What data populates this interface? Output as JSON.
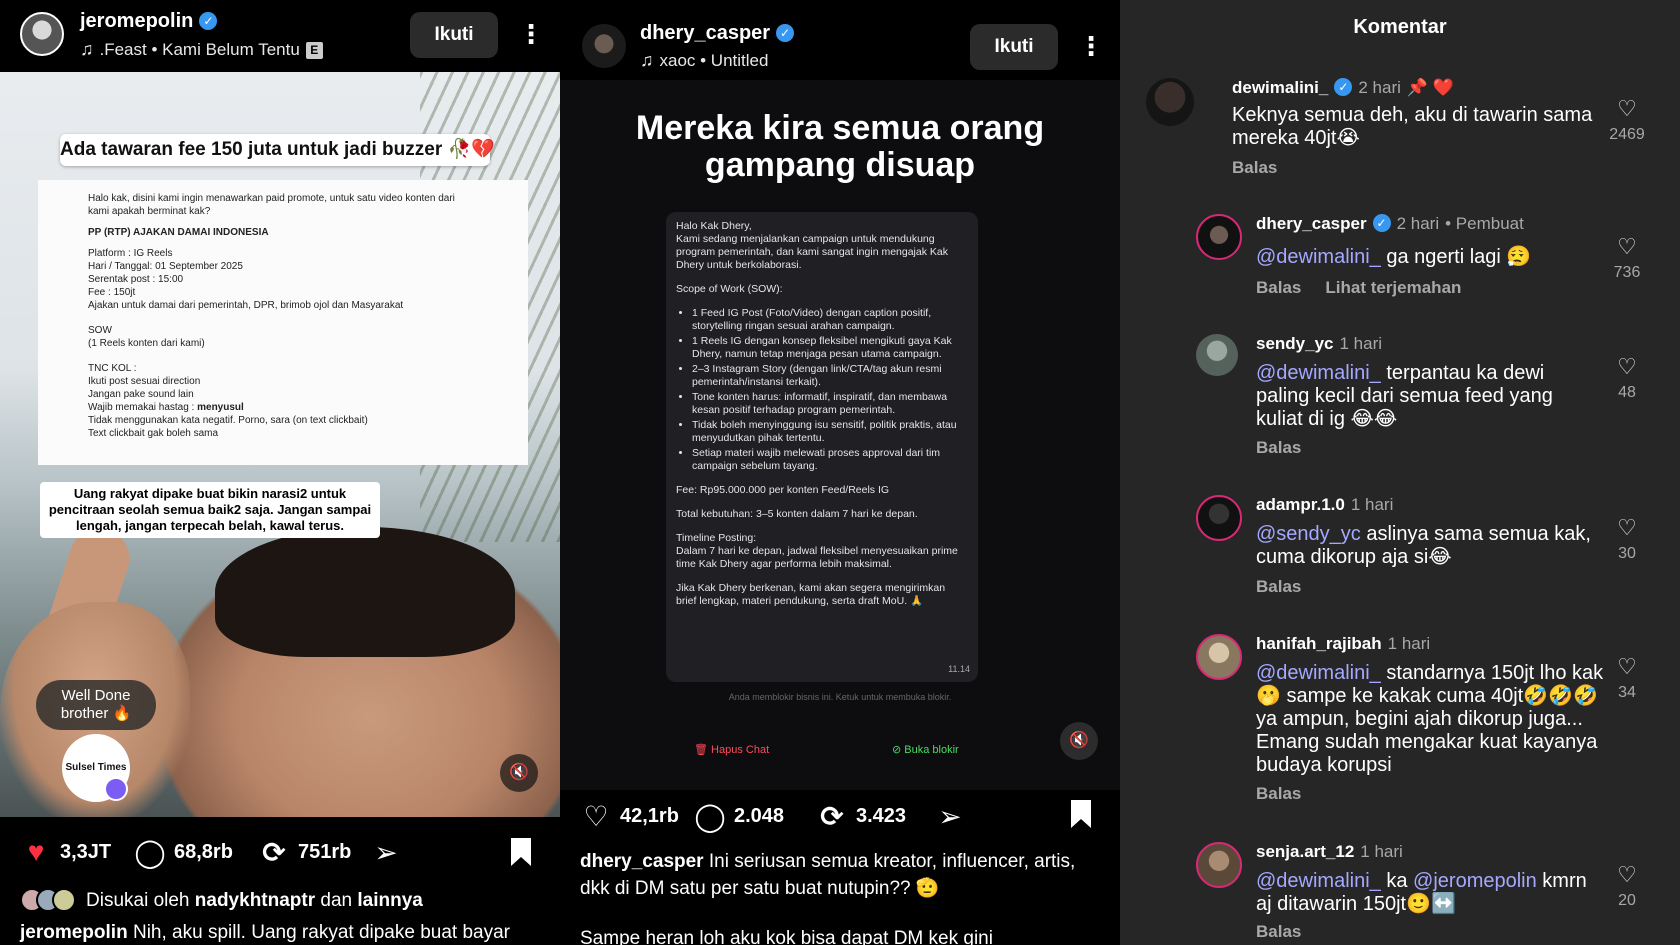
{
  "left_post": {
    "username": "jeromepolin",
    "music": ".Feast • Kami Belum Tentu",
    "explicit_badge": "E",
    "follow_label": "Ikuti",
    "headline": "Ada tawaran fee 150 juta untuk jadi buzzer 🥀💔",
    "doc": {
      "intro": "Halo kak, disini kami ingin menawarkan paid promote, untuk satu video konten dari kami apakah berminat kak?",
      "heading": "PP (RTP) AJAKAN DAMAI INDONESIA",
      "platform": "Platform : IG Reels",
      "date": "Hari / Tanggal: 01 September 2025",
      "post": "Serentak post : 15:00",
      "fee": "Fee : 150jt",
      "ajakan": "Ajakan untuk damai dari pemerintah, DPR, brimob ojol dan Masyarakat",
      "sow": "SOW",
      "sow_item": "(1 Reels konten dari kami)",
      "tnc": "TNC KOL :",
      "tnc_1": "Ikuti post sesuai direction",
      "tnc_2": "Jangan pake sound lain",
      "tnc_3_prefix": "Wajib memakai hastag : ",
      "tnc_3_bold": "menyusul",
      "tnc_4": "Tidak menggunakan kata negatif. Porno, sara (on text clickbait)",
      "tnc_5": "Text clickbait gak boleh sama"
    },
    "overlay_caption": "Uang rakyat dipake buat bikin narasi2 untuk pencitraan seolah semua baik2 saja. Jangan sampai lengah, jangan terpecah belah, kawal terus.",
    "sticker_text": "Well Done brother 🔥",
    "sticker_logo": "Sulsel Times",
    "likes": "3,3JT",
    "comments": "68,8rb",
    "reposts": "751rb",
    "liked_by_prefix": "Disukai oleh ",
    "liked_by_user": "nadykhtnaptr",
    "liked_by_and": " dan ",
    "liked_by_others": "lainnya",
    "caption_user": "jeromepolin",
    "caption_text": " Nih, aku spill. Uang rakyat dipake buat bayar"
  },
  "middle_post": {
    "username": "dhery_casper",
    "music": "xaoc • Untitled",
    "follow_label": "Ikuti",
    "title": "Mereka kira semua orang gampang disuap",
    "chat": {
      "greeting": "Halo Kak Dhery,",
      "intro": "Kami sedang menjalankan campaign untuk mendukung program pemerintah, dan kami sangat ingin mengajak Kak Dhery untuk berkolaborasi.",
      "sow_title": "Scope of Work (SOW):",
      "sow_items": [
        "1 Feed IG Post (Foto/Video) dengan caption positif, storytelling ringan sesuai arahan campaign.",
        "1 Reels IG dengan konsep fleksibel mengikuti gaya Kak Dhery, namun tetap menjaga pesan utama campaign.",
        "2–3 Instagram Story (dengan link/CTA/tag akun resmi pemerintah/instansi terkait).",
        "Tone konten harus: informatif, inspiratif, dan membawa kesan positif terhadap program pemerintah.",
        "Tidak boleh menyinggung isu sensitif, politik praktis, atau menyudutkan pihak tertentu.",
        "Setiap materi wajib melewati proses approval dari tim campaign sebelum tayang."
      ],
      "fee": "Fee: Rp95.000.000 per konten Feed/Reels IG",
      "total": "Total kebutuhan: 3–5 konten dalam 7 hari ke depan.",
      "timeline_title": "Timeline Posting:",
      "timeline": "Dalam 7 hari ke depan, jadwal fleksibel menyesuaikan prime time Kak Dhery agar performa lebih maksimal.",
      "closing": "Jika Kak Dhery berkenan, kami akan segera mengirimkan brief lengkap, materi pendukung, serta draft MoU. 🙏",
      "time": "11.14"
    },
    "blocked_note": "Anda memblokir bisnis ini. Ketuk untuk membuka blokir.",
    "delete_chat": "Hapus Chat",
    "unblock": "Buka blokir",
    "likes": "42,1rb",
    "comments": "2.048",
    "reposts": "3.423",
    "caption_user": "dhery_casper",
    "caption_text": " Ini seriusan semua kreator, influencer, artis, dkk di DM satu per satu buat nutupin?? 🫡",
    "caption_more": "Sampe heran loh aku kok bisa dapat DM kek gini"
  },
  "comments_panel": {
    "title": "Komentar",
    "reply_label": "Balas",
    "translate_label": "Lihat terjemahan",
    "items": [
      {
        "user": "dewimalini_",
        "time": "2 hari",
        "extra": "📌 ❤️",
        "mention": "",
        "text": "Keknya semua deh, aku di tawarin sama mereka 40jt😭",
        "likes": "2469"
      },
      {
        "user": "dhery_casper",
        "time": "2 hari",
        "extra": "• Pembuat",
        "mention": "@dewimalini_",
        "text": " ga ngerti lagi 😮‍💨",
        "likes": "736"
      },
      {
        "user": "sendy_yc",
        "time": "1 hari",
        "extra": "",
        "mention": "@dewimalini_",
        "text": " terpantau ka dewi paling kecil dari semua feed yang kuliat di ig 😂😂",
        "likes": "48"
      },
      {
        "user": "adampr.1.0",
        "time": "1 hari",
        "extra": "",
        "mention": "@sendy_yc",
        "text": " aslinya sama semua kak, cuma dikorup aja si😂",
        "likes": "30"
      },
      {
        "user": "hanifah_rajibah",
        "time": "1 hari",
        "extra": "",
        "mention": "@dewimalini_",
        "text": " standarnya 150jt lho kak🫢 sampe ke kakak cuma 40jt🤣🤣🤣 ya ampun, begini ajah dikorup juga... Emang sudah mengakar kuat kayanya budaya korupsi",
        "likes": "34"
      },
      {
        "user": "senja.art_12",
        "time": "1 hari",
        "extra": "",
        "mention": "@dewimalini_",
        "text": " ka ",
        "mention2": "@jeromepolin",
        "text2": " kmrn aj ditawarin 150jt🙂↔️",
        "likes": "20"
      }
    ]
  },
  "colors": {
    "like_red": "#ff3040",
    "verified_blue": "#3897f0",
    "mention": "#a5a8ff",
    "comments_bg": "#262626"
  },
  "icons": [
    "verified-icon",
    "music-note-icon",
    "more-icon",
    "heart-icon",
    "comment-icon",
    "repost-icon",
    "share-icon",
    "bookmark-icon",
    "mute-icon",
    "trash-icon",
    "unblock-icon"
  ]
}
